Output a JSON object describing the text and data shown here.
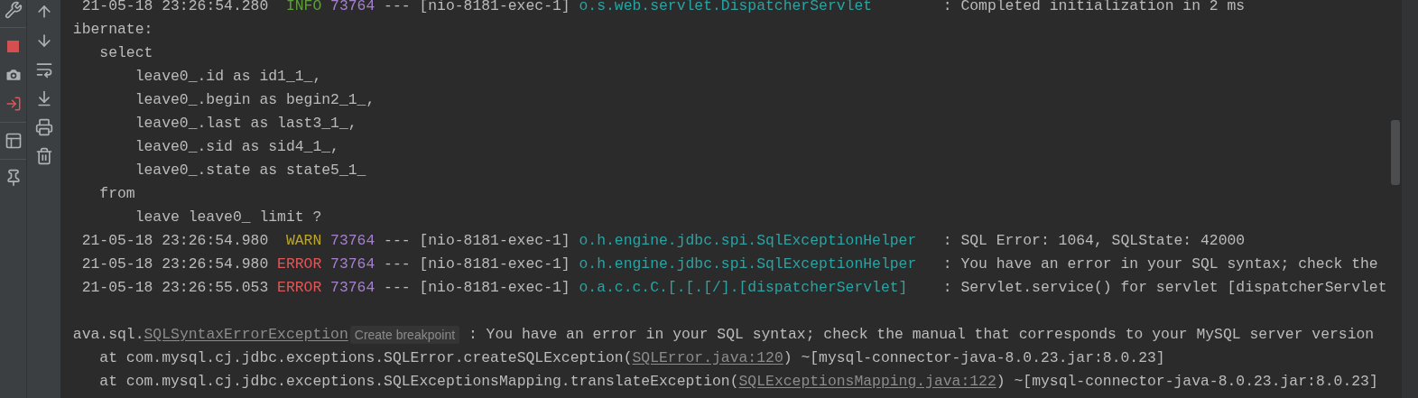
{
  "console": {
    "lines": [
      {
        "kind": "log",
        "timestamp": "21-05-18 23:26:54.280",
        "level": {
          "text": "INFO",
          "kind": "info"
        },
        "pid": "73764",
        "separator": "---",
        "thread": "[nio-8181-exec-1]",
        "logger": "o.s.web.servlet.DispatcherServlet",
        "message": ": Completed initialization in 2 ms"
      },
      {
        "kind": "text",
        "segments": [
          {
            "kind": "plain",
            "text": "ibernate:"
          }
        ]
      },
      {
        "kind": "text",
        "segments": [
          {
            "kind": "plain",
            "text": "   select"
          }
        ]
      },
      {
        "kind": "text",
        "segments": [
          {
            "kind": "plain",
            "text": "       leave0_.id as id1_1_,"
          }
        ]
      },
      {
        "kind": "text",
        "segments": [
          {
            "kind": "plain",
            "text": "       leave0_.begin as begin2_1_,"
          }
        ]
      },
      {
        "kind": "text",
        "segments": [
          {
            "kind": "plain",
            "text": "       leave0_.last as last3_1_,"
          }
        ]
      },
      {
        "kind": "text",
        "segments": [
          {
            "kind": "plain",
            "text": "       leave0_.sid as sid4_1_,"
          }
        ]
      },
      {
        "kind": "text",
        "segments": [
          {
            "kind": "plain",
            "text": "       leave0_.state as state5_1_"
          }
        ]
      },
      {
        "kind": "text",
        "segments": [
          {
            "kind": "plain",
            "text": "   from"
          }
        ]
      },
      {
        "kind": "text",
        "segments": [
          {
            "kind": "plain",
            "text": "       leave leave0_ limit ?"
          }
        ]
      },
      {
        "kind": "log",
        "timestamp": "21-05-18 23:26:54.980",
        "level": {
          "text": "WARN",
          "kind": "warn"
        },
        "pid": "73764",
        "separator": "---",
        "thread": "[nio-8181-exec-1]",
        "logger": "o.h.engine.jdbc.spi.SqlExceptionHelper",
        "message": ": SQL Error: 1064, SQLState: 42000"
      },
      {
        "kind": "log",
        "timestamp": "21-05-18 23:26:54.980",
        "level": {
          "text": "ERROR",
          "kind": "error"
        },
        "pid": "73764",
        "separator": "---",
        "thread": "[nio-8181-exec-1]",
        "logger": "o.h.engine.jdbc.spi.SqlExceptionHelper",
        "message": ": You have an error in your SQL syntax; check the"
      },
      {
        "kind": "log",
        "timestamp": "21-05-18 23:26:55.053",
        "level": {
          "text": "ERROR",
          "kind": "error"
        },
        "pid": "73764",
        "separator": "---",
        "thread": "[nio-8181-exec-1]",
        "logger": "o.a.c.c.C.[.[.[/].[dispatcherServlet]",
        "message": ": Servlet.service() for servlet [dispatcherServlet"
      },
      {
        "kind": "blank"
      },
      {
        "kind": "text",
        "segments": [
          {
            "kind": "plain",
            "text": "ava.sql."
          },
          {
            "kind": "link",
            "text": "SQLSyntaxErrorException"
          },
          {
            "kind": "hint",
            "text": "Create breakpoint"
          },
          {
            "kind": "plain",
            "text": " : You have an error in your SQL syntax; check the manual that corresponds to your MySQL server version"
          }
        ]
      },
      {
        "kind": "text",
        "segments": [
          {
            "kind": "plain",
            "text": "   at com.mysql.cj.jdbc.exceptions.SQLError.createSQLException("
          },
          {
            "kind": "link",
            "text": "SQLError.java:120"
          },
          {
            "kind": "plain",
            "text": ") ~[mysql-connector-java-8.0.23.jar:8.0.23]"
          }
        ]
      },
      {
        "kind": "text",
        "segments": [
          {
            "kind": "plain",
            "text": "   at com.mysql.cj.jdbc.exceptions.SQLExceptionsMapping.translateException("
          },
          {
            "kind": "link",
            "text": "SQLExceptionsMapping.java:122"
          },
          {
            "kind": "plain",
            "text": ") ~[mysql-connector-java-8.0.23.jar:8.0.23]"
          }
        ]
      }
    ]
  }
}
